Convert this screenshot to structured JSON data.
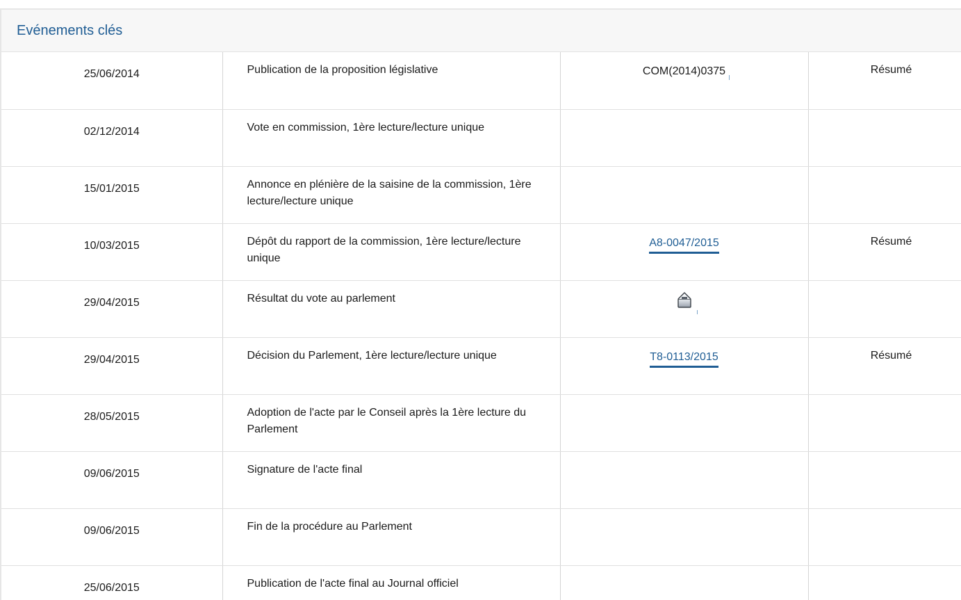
{
  "section": {
    "title": "Evénements clés"
  },
  "events": [
    {
      "date": "25/06/2014",
      "event": "Publication de la proposition législative",
      "doc": "COM(2014)0375",
      "doc_type": "plain",
      "summary": "Résumé"
    },
    {
      "date": "02/12/2014",
      "event": "Vote en commission, 1ère lecture/lecture unique",
      "doc": "",
      "doc_type": "none",
      "summary": ""
    },
    {
      "date": "15/01/2015",
      "event": "Annonce en plénière de la saisine de la commission, 1ère lecture/lecture unique",
      "doc": "",
      "doc_type": "none",
      "summary": ""
    },
    {
      "date": "10/03/2015",
      "event": "Dépôt du rapport de la commission, 1ère lecture/lecture unique",
      "doc": "A8-0047/2015",
      "doc_type": "link",
      "summary": "Résumé"
    },
    {
      "date": "29/04/2015",
      "event": "Résultat du vote au parlement",
      "doc": "",
      "doc_type": "vote-icon",
      "summary": ""
    },
    {
      "date": "29/04/2015",
      "event": "Décision du Parlement, 1ère lecture/lecture unique",
      "doc": "T8-0113/2015",
      "doc_type": "link",
      "summary": "Résumé"
    },
    {
      "date": "28/05/2015",
      "event": "Adoption de l'acte par le Conseil après la 1ère lecture du Parlement",
      "doc": "",
      "doc_type": "none",
      "summary": ""
    },
    {
      "date": "09/06/2015",
      "event": "Signature de l'acte final",
      "doc": "",
      "doc_type": "none",
      "summary": ""
    },
    {
      "date": "09/06/2015",
      "event": "Fin de la procédure au Parlement",
      "doc": "",
      "doc_type": "none",
      "summary": ""
    },
    {
      "date": "25/06/2015",
      "event": "Publication de l'acte final au Journal officiel",
      "doc": "",
      "doc_type": "none",
      "summary": ""
    }
  ],
  "colors": {
    "link": "#1f5d94",
    "header_bg": "#f7f7f7",
    "border": "#d4d4d4"
  }
}
